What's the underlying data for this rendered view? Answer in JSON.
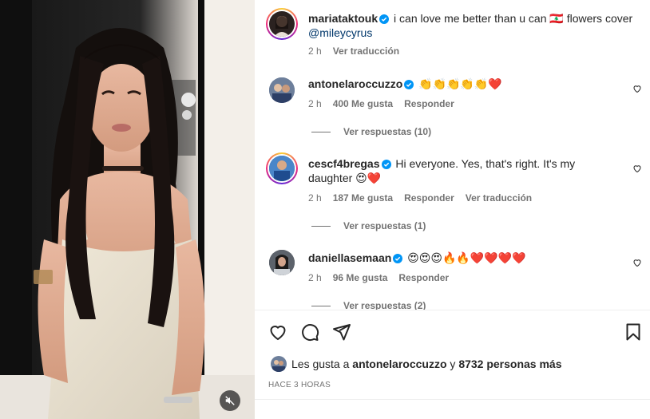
{
  "post": {
    "author": "mariataktouk",
    "caption": "i can love me better than u can 🇱🇧 flowers cover ",
    "mention": "@mileycyrus",
    "time": "2 h",
    "translate": "Ver traducción"
  },
  "comments": [
    {
      "username": "antonelaroccuzzo",
      "text": "👏👏👏👏👏❤️",
      "time": "2 h",
      "likes": "400 Me gusta",
      "reply": "Responder",
      "view_replies": "Ver respuestas (10)"
    },
    {
      "username": "cescf4bregas",
      "text_line1": "Hi everyone. Yes, that's right. It's my",
      "text_line2": "daughter 😍❤️",
      "time": "2 h",
      "likes": "187 Me gusta",
      "reply": "Responder",
      "translate": "Ver traducción",
      "view_replies": "Ver respuestas (1)"
    },
    {
      "username": "daniellasemaan",
      "text": "😍😍😍🔥🔥❤️❤️❤️❤️",
      "time": "2 h",
      "likes": "96 Me gusta",
      "reply": "Responder",
      "view_replies": "Ver respuestas (2)"
    }
  ],
  "likes": {
    "prefix": "Les gusta a ",
    "user": "antonelaroccuzzo",
    "joiner": " y ",
    "others": "8732 personas más"
  },
  "timestamp": "HACE 3 HORAS",
  "colors": {
    "text": "#262626",
    "secondary": "#737373",
    "link": "#00376b",
    "verified": "#0095f6",
    "heart": "#ed4956"
  },
  "icons": {
    "like": "heart-icon",
    "comment": "comment-icon",
    "share": "paper-plane-icon",
    "save": "bookmark-icon",
    "mute": "muted-speaker-icon",
    "verified": "verified-badge-icon"
  }
}
